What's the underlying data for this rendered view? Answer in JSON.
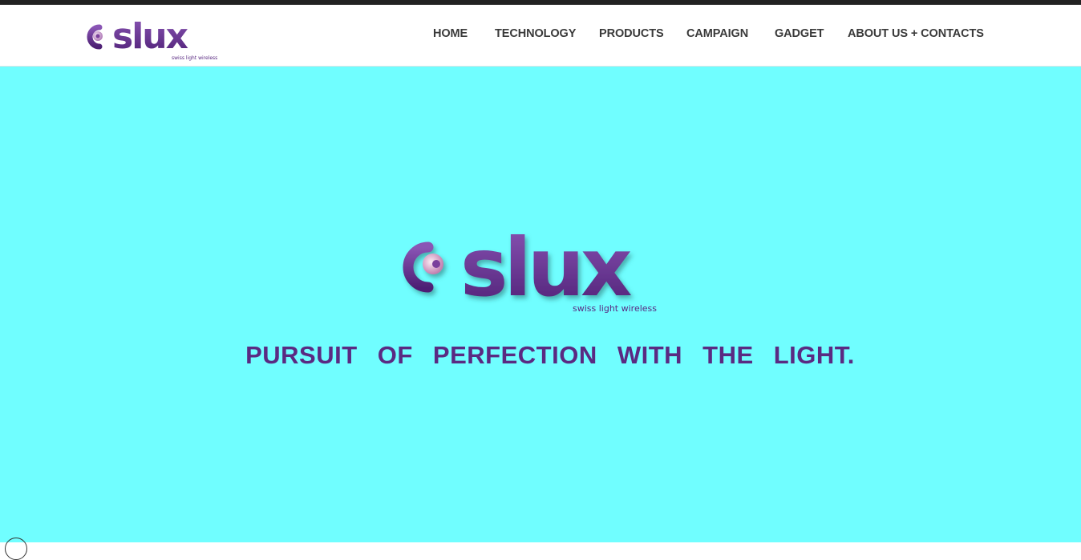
{
  "brand": {
    "name": "slux",
    "tagline_small": "swiss light wireless"
  },
  "nav": {
    "items": [
      {
        "label": "HOME"
      },
      {
        "label": "TECHNOLOGY"
      },
      {
        "label": "PRODUCTS"
      },
      {
        "label": "CAMPAIGN"
      },
      {
        "label": "GADGET"
      },
      {
        "label": "ABOUT US + CONTACTS"
      }
    ]
  },
  "hero": {
    "logo_text": "slux",
    "logo_subtext": "swiss light wireless",
    "tagline": "PURSUIT OF PERFECTION WITH THE LIGHT."
  },
  "colors": {
    "hero_background": "#70feff",
    "brand_purple": "#5a2a82",
    "nav_text": "#3a3a3a",
    "top_bar": "#222222"
  }
}
